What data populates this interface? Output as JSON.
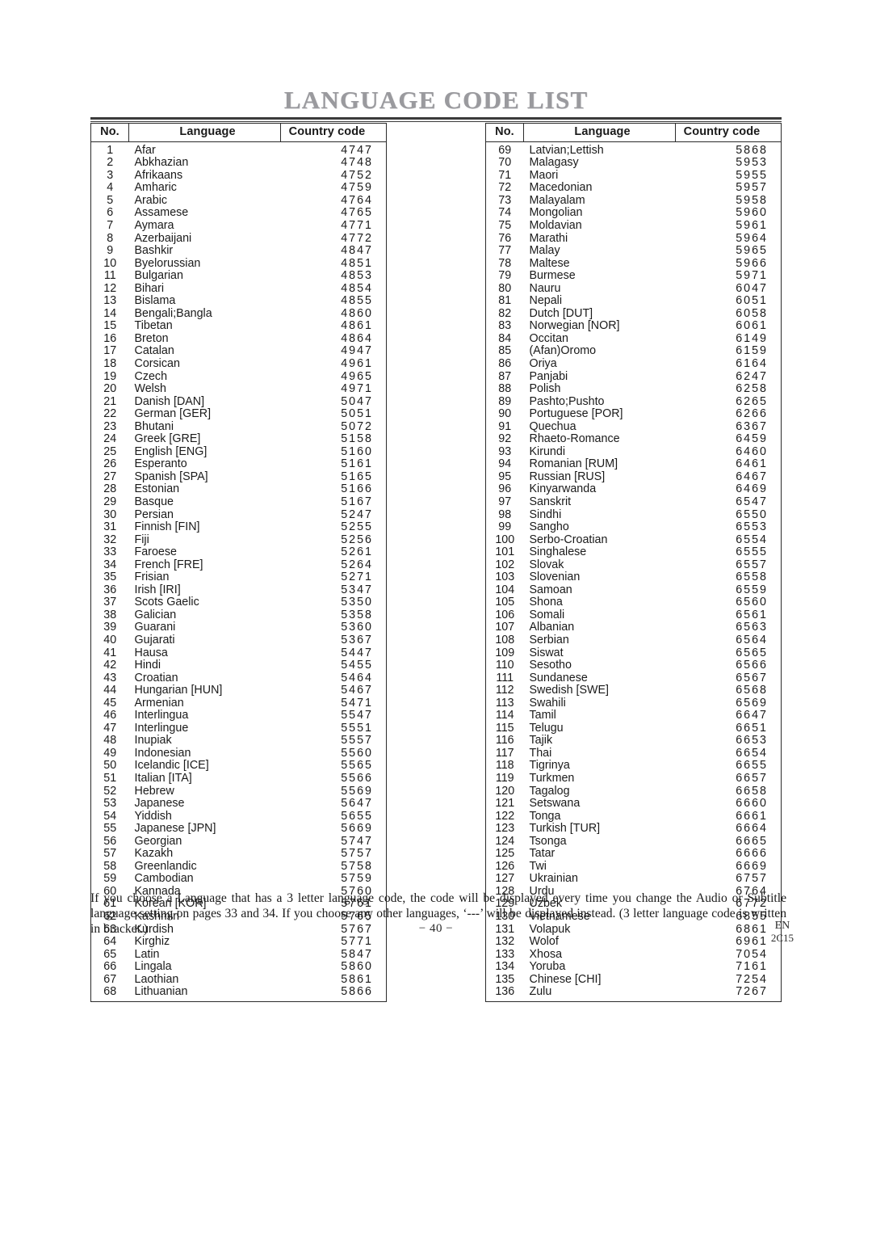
{
  "document": {
    "title": "LANGUAGE CODE LIST",
    "page_number": "− 40 −",
    "footer_region": "EN",
    "footer_code": "2C15",
    "footnote": "If you choose a Language that has a 3 letter language code, the code will be displayed every time you change the Audio or Subtitle language setting on pages 33 and 34. If you choose any other languages, ‘---’ will be displayed instead. (3 letter language code is written in bracket.)"
  },
  "table_headers": {
    "no": "No.",
    "language": "Language",
    "country_code": "Country code"
  },
  "left_table": [
    {
      "no": "1",
      "language": "Afar",
      "code": "4747"
    },
    {
      "no": "2",
      "language": "Abkhazian",
      "code": "4748"
    },
    {
      "no": "3",
      "language": "Afrikaans",
      "code": "4752"
    },
    {
      "no": "4",
      "language": "Amharic",
      "code": "4759"
    },
    {
      "no": "5",
      "language": "Arabic",
      "code": "4764"
    },
    {
      "no": "6",
      "language": "Assamese",
      "code": "4765"
    },
    {
      "no": "7",
      "language": "Aymara",
      "code": "4771"
    },
    {
      "no": "8",
      "language": "Azerbaijani",
      "code": "4772"
    },
    {
      "no": "9",
      "language": "Bashkir",
      "code": "4847"
    },
    {
      "no": "10",
      "language": "Byelorussian",
      "code": "4851"
    },
    {
      "no": "11",
      "language": "Bulgarian",
      "code": "4853"
    },
    {
      "no": "12",
      "language": "Bihari",
      "code": "4854"
    },
    {
      "no": "13",
      "language": "Bislama",
      "code": "4855"
    },
    {
      "no": "14",
      "language": "Bengali;Bangla",
      "code": "4860"
    },
    {
      "no": "15",
      "language": "Tibetan",
      "code": "4861"
    },
    {
      "no": "16",
      "language": "Breton",
      "code": "4864"
    },
    {
      "no": "17",
      "language": "Catalan",
      "code": "4947"
    },
    {
      "no": "18",
      "language": "Corsican",
      "code": "4961"
    },
    {
      "no": "19",
      "language": "Czech",
      "code": "4965"
    },
    {
      "no": "20",
      "language": "Welsh",
      "code": "4971"
    },
    {
      "no": "21",
      "language": "Danish [DAN]",
      "code": "5047"
    },
    {
      "no": "22",
      "language": "German [GER]",
      "code": "5051"
    },
    {
      "no": "23",
      "language": "Bhutani",
      "code": "5072"
    },
    {
      "no": "24",
      "language": "Greek [GRE]",
      "code": "5158"
    },
    {
      "no": "25",
      "language": "English [ENG]",
      "code": "5160"
    },
    {
      "no": "26",
      "language": "Esperanto",
      "code": "5161"
    },
    {
      "no": "27",
      "language": "Spanish [SPA]",
      "code": "5165"
    },
    {
      "no": "28",
      "language": "Estonian",
      "code": "5166"
    },
    {
      "no": "29",
      "language": "Basque",
      "code": "5167"
    },
    {
      "no": "30",
      "language": "Persian",
      "code": "5247"
    },
    {
      "no": "31",
      "language": "Finnish [FIN]",
      "code": "5255"
    },
    {
      "no": "32",
      "language": "Fiji",
      "code": "5256"
    },
    {
      "no": "33",
      "language": "Faroese",
      "code": "5261"
    },
    {
      "no": "34",
      "language": "French [FRE]",
      "code": "5264"
    },
    {
      "no": "35",
      "language": "Frisian",
      "code": "5271"
    },
    {
      "no": "36",
      "language": "Irish [IRI]",
      "code": "5347"
    },
    {
      "no": "37",
      "language": "Scots Gaelic",
      "code": "5350"
    },
    {
      "no": "38",
      "language": "Galician",
      "code": "5358"
    },
    {
      "no": "39",
      "language": "Guarani",
      "code": "5360"
    },
    {
      "no": "40",
      "language": "Gujarati",
      "code": "5367"
    },
    {
      "no": "41",
      "language": "Hausa",
      "code": "5447"
    },
    {
      "no": "42",
      "language": "Hindi",
      "code": "5455"
    },
    {
      "no": "43",
      "language": "Croatian",
      "code": "5464"
    },
    {
      "no": "44",
      "language": "Hungarian [HUN]",
      "code": "5467"
    },
    {
      "no": "45",
      "language": "Armenian",
      "code": "5471"
    },
    {
      "no": "46",
      "language": "Interlingua",
      "code": "5547"
    },
    {
      "no": "47",
      "language": "Interlingue",
      "code": "5551"
    },
    {
      "no": "48",
      "language": "Inupiak",
      "code": "5557"
    },
    {
      "no": "49",
      "language": "Indonesian",
      "code": "5560"
    },
    {
      "no": "50",
      "language": "Icelandic [ICE]",
      "code": "5565"
    },
    {
      "no": "51",
      "language": "Italian [ITA]",
      "code": "5566"
    },
    {
      "no": "52",
      "language": "Hebrew",
      "code": "5569"
    },
    {
      "no": "53",
      "language": "Japanese",
      "code": "5647"
    },
    {
      "no": "54",
      "language": "Yiddish",
      "code": "5655"
    },
    {
      "no": "55",
      "language": "Japanese [JPN]",
      "code": "5669"
    },
    {
      "no": "56",
      "language": "Georgian",
      "code": "5747"
    },
    {
      "no": "57",
      "language": "Kazakh",
      "code": "5757"
    },
    {
      "no": "58",
      "language": "Greenlandic",
      "code": "5758"
    },
    {
      "no": "59",
      "language": "Cambodian",
      "code": "5759"
    },
    {
      "no": "60",
      "language": "Kannada",
      "code": "5760"
    },
    {
      "no": "61",
      "language": "Korean [KOR]",
      "code": "5761"
    },
    {
      "no": "62",
      "language": "Kashmiri",
      "code": "5765"
    },
    {
      "no": "63",
      "language": "Kurdish",
      "code": "5767"
    },
    {
      "no": "64",
      "language": "Kirghiz",
      "code": "5771"
    },
    {
      "no": "65",
      "language": "Latin",
      "code": "5847"
    },
    {
      "no": "66",
      "language": "Lingala",
      "code": "5860"
    },
    {
      "no": "67",
      "language": "Laothian",
      "code": "5861"
    },
    {
      "no": "68",
      "language": "Lithuanian",
      "code": "5866"
    }
  ],
  "right_table": [
    {
      "no": "69",
      "language": "Latvian;Lettish",
      "code": "5868"
    },
    {
      "no": "70",
      "language": "Malagasy",
      "code": "5953"
    },
    {
      "no": "71",
      "language": "Maori",
      "code": "5955"
    },
    {
      "no": "72",
      "language": "Macedonian",
      "code": "5957"
    },
    {
      "no": "73",
      "language": "Malayalam",
      "code": "5958"
    },
    {
      "no": "74",
      "language": "Mongolian",
      "code": "5960"
    },
    {
      "no": "75",
      "language": "Moldavian",
      "code": "5961"
    },
    {
      "no": "76",
      "language": "Marathi",
      "code": "5964"
    },
    {
      "no": "77",
      "language": "Malay",
      "code": "5965"
    },
    {
      "no": "78",
      "language": "Maltese",
      "code": "5966"
    },
    {
      "no": "79",
      "language": "Burmese",
      "code": "5971"
    },
    {
      "no": "80",
      "language": "Nauru",
      "code": "6047"
    },
    {
      "no": "81",
      "language": "Nepali",
      "code": "6051"
    },
    {
      "no": "82",
      "language": "Dutch [DUT]",
      "code": "6058"
    },
    {
      "no": "83",
      "language": "Norwegian [NOR]",
      "code": "6061"
    },
    {
      "no": "84",
      "language": "Occitan",
      "code": "6149"
    },
    {
      "no": "85",
      "language": "(Afan)Oromo",
      "code": "6159"
    },
    {
      "no": "86",
      "language": "Oriya",
      "code": "6164"
    },
    {
      "no": "87",
      "language": "Panjabi",
      "code": "6247"
    },
    {
      "no": "88",
      "language": "Polish",
      "code": "6258"
    },
    {
      "no": "89",
      "language": "Pashto;Pushto",
      "code": "6265"
    },
    {
      "no": "90",
      "language": "Portuguese [POR]",
      "code": "6266"
    },
    {
      "no": "91",
      "language": "Quechua",
      "code": "6367"
    },
    {
      "no": "92",
      "language": "Rhaeto-Romance",
      "code": "6459"
    },
    {
      "no": "93",
      "language": "Kirundi",
      "code": "6460"
    },
    {
      "no": "94",
      "language": "Romanian [RUM]",
      "code": "6461"
    },
    {
      "no": "95",
      "language": "Russian [RUS]",
      "code": "6467"
    },
    {
      "no": "96",
      "language": "Kinyarwanda",
      "code": "6469"
    },
    {
      "no": "97",
      "language": "Sanskrit",
      "code": "6547"
    },
    {
      "no": "98",
      "language": "Sindhi",
      "code": "6550"
    },
    {
      "no": "99",
      "language": "Sangho",
      "code": "6553"
    },
    {
      "no": "100",
      "language": "Serbo-Croatian",
      "code": "6554"
    },
    {
      "no": "101",
      "language": "Singhalese",
      "code": "6555"
    },
    {
      "no": "102",
      "language": "Slovak",
      "code": "6557"
    },
    {
      "no": "103",
      "language": "Slovenian",
      "code": "6558"
    },
    {
      "no": "104",
      "language": "Samoan",
      "code": "6559"
    },
    {
      "no": "105",
      "language": "Shona",
      "code": "6560"
    },
    {
      "no": "106",
      "language": "Somali",
      "code": "6561"
    },
    {
      "no": "107",
      "language": "Albanian",
      "code": "6563"
    },
    {
      "no": "108",
      "language": "Serbian",
      "code": "6564"
    },
    {
      "no": "109",
      "language": "Siswat",
      "code": "6565"
    },
    {
      "no": "110",
      "language": "Sesotho",
      "code": "6566"
    },
    {
      "no": "111",
      "language": "Sundanese",
      "code": "6567"
    },
    {
      "no": "112",
      "language": "Swedish [SWE]",
      "code": "6568"
    },
    {
      "no": "113",
      "language": "Swahili",
      "code": "6569"
    },
    {
      "no": "114",
      "language": "Tamil",
      "code": "6647"
    },
    {
      "no": "115",
      "language": "Telugu",
      "code": "6651"
    },
    {
      "no": "116",
      "language": "Tajik",
      "code": "6653"
    },
    {
      "no": "117",
      "language": "Thai",
      "code": "6654"
    },
    {
      "no": "118",
      "language": "Tigrinya",
      "code": "6655"
    },
    {
      "no": "119",
      "language": "Turkmen",
      "code": "6657"
    },
    {
      "no": "120",
      "language": "Tagalog",
      "code": "6658"
    },
    {
      "no": "121",
      "language": "Setswana",
      "code": "6660"
    },
    {
      "no": "122",
      "language": "Tonga",
      "code": "6661"
    },
    {
      "no": "123",
      "language": "Turkish [TUR]",
      "code": "6664"
    },
    {
      "no": "124",
      "language": "Tsonga",
      "code": "6665"
    },
    {
      "no": "125",
      "language": "Tatar",
      "code": "6666"
    },
    {
      "no": "126",
      "language": "Twi",
      "code": "6669"
    },
    {
      "no": "127",
      "language": "Ukrainian",
      "code": "6757"
    },
    {
      "no": "128",
      "language": "Urdu",
      "code": "6764"
    },
    {
      "no": "129",
      "language": "Uzbek",
      "code": "6772"
    },
    {
      "no": "130",
      "language": "Vietnamese",
      "code": "6855"
    },
    {
      "no": "131",
      "language": "Volapuk",
      "code": "6861"
    },
    {
      "no": "132",
      "language": "Wolof",
      "code": "6961"
    },
    {
      "no": "133",
      "language": "Xhosa",
      "code": "7054"
    },
    {
      "no": "134",
      "language": "Yoruba",
      "code": "7161"
    },
    {
      "no": "135",
      "language": "Chinese [CHI]",
      "code": "7254"
    },
    {
      "no": "136",
      "language": "Zulu",
      "code": "7267"
    }
  ]
}
